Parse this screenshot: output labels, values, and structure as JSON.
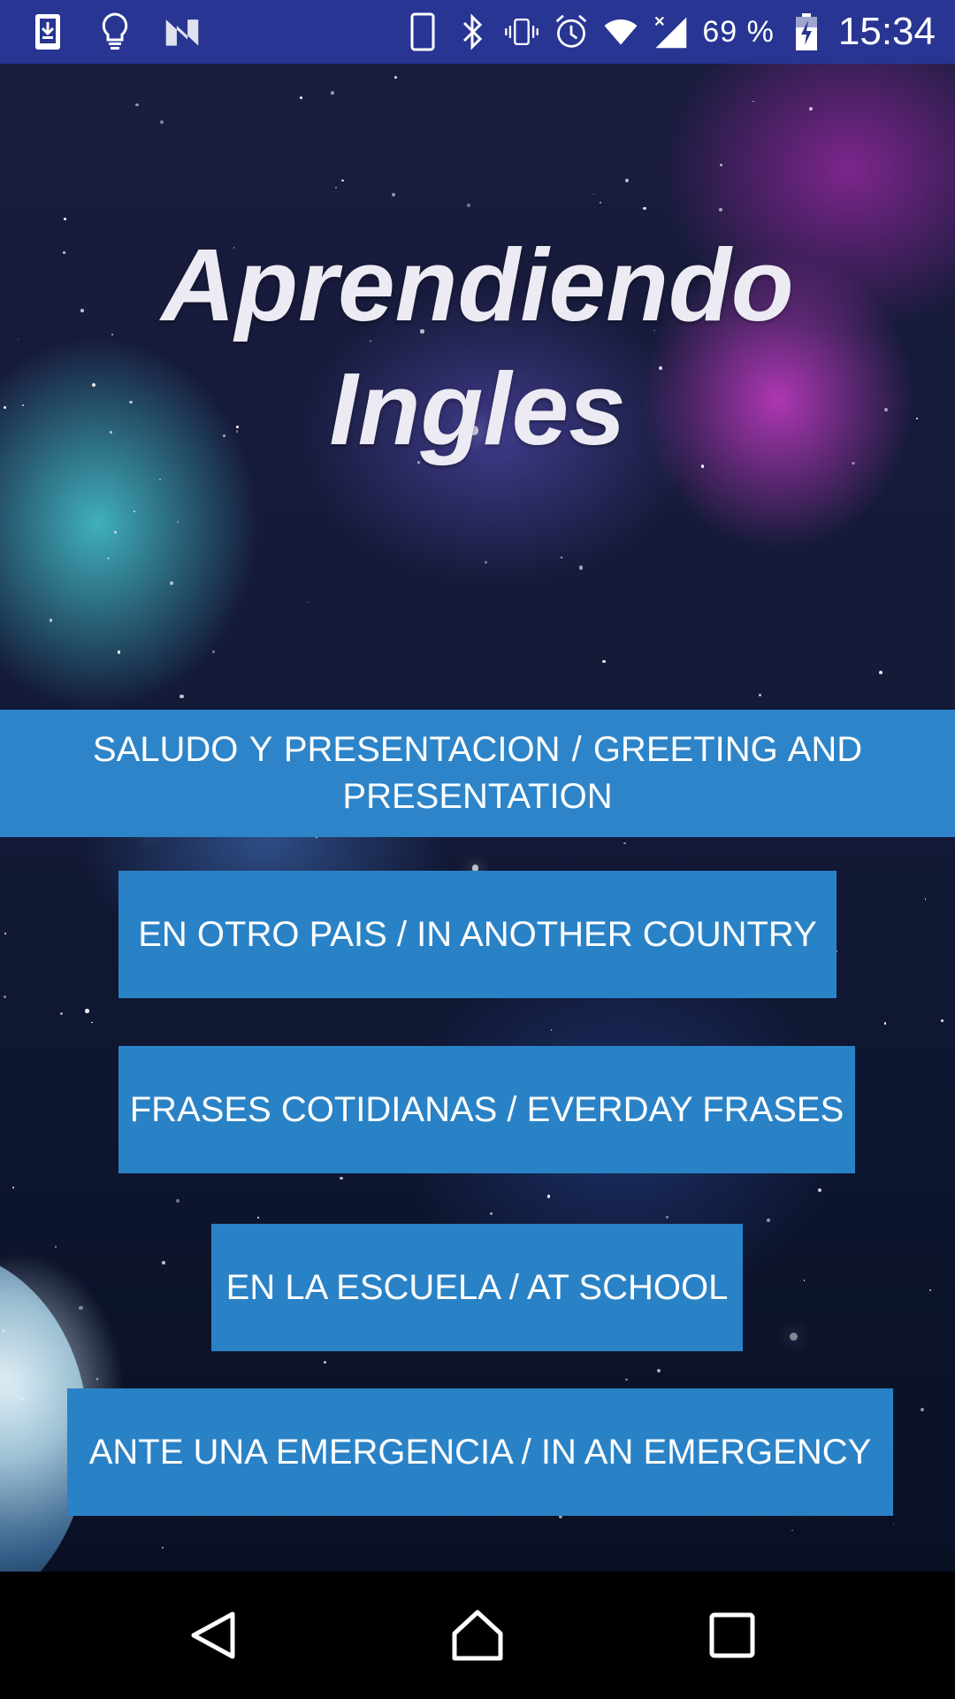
{
  "status_bar": {
    "left_icons": [
      "download-done-icon",
      "lightbulb-icon",
      "n-logo-icon"
    ],
    "right_icons": [
      "phone-icon",
      "bluetooth-icon",
      "vibrate-icon",
      "alarm-icon",
      "wifi-icon",
      "signal-icon",
      "battery-charging-icon"
    ],
    "battery_percent": "69 %",
    "time": "15:34",
    "background_color": "#283593"
  },
  "app": {
    "title_line1": "Aprendiendo",
    "title_line2": "Ingles"
  },
  "menu": {
    "greeting": "SALUDO Y PRESENTACION /      GREETING AND PRESENTATION",
    "another_country": "EN OTRO PAIS / IN ANOTHER COUNTRY",
    "everyday_phrases": "FRASES COTIDIANAS / EVERDAY FRASES",
    "at_school": "EN LA ESCUELA / AT SCHOOL",
    "emergency": "ANTE UNA EMERGENCIA / IN AN EMERGENCY",
    "button_color": "#2a82c6"
  },
  "nav_bar": {
    "buttons": [
      "back-icon",
      "home-icon",
      "recents-icon"
    ]
  }
}
